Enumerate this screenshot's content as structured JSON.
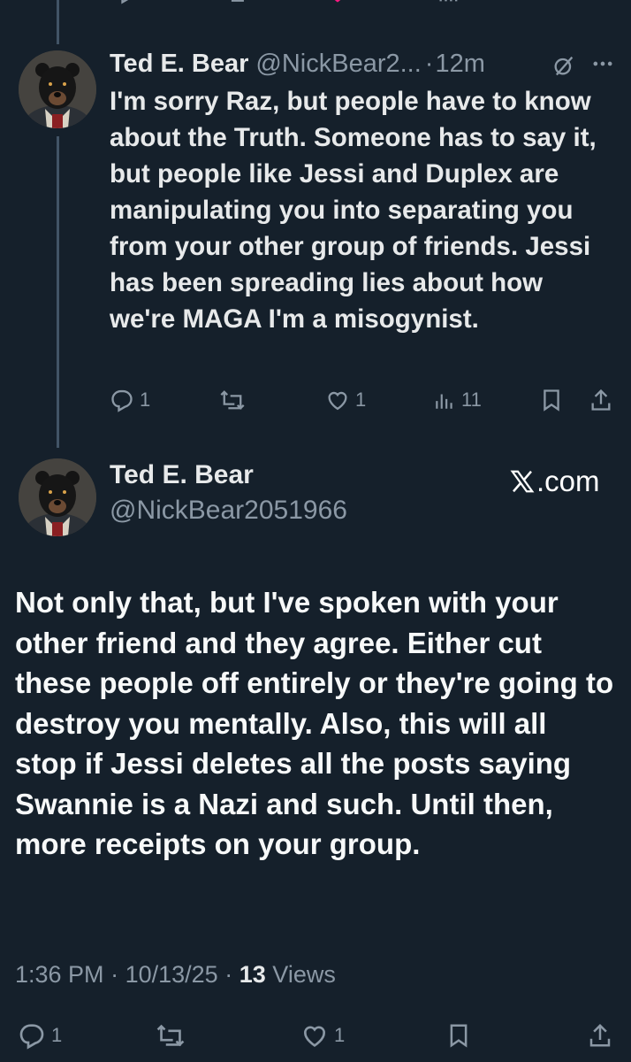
{
  "reply": {
    "name": "Ted E. Bear",
    "handle": "@NickBear2...",
    "separator": "·",
    "time": "12m",
    "text": "I'm sorry Raz, but people have to know about the Truth. Someone has to say it, but people like Jessi and Duplex are manipulating you into separating you from your other group of friends. Jessi has been spreading lies about how we're MAGA I'm a misogynist.",
    "actions": {
      "replies": "1",
      "reposts": "",
      "likes": "1",
      "views": "11"
    }
  },
  "main_post": {
    "name": "Ted E. Bear",
    "handle": "@NickBear2051966",
    "source": ".com",
    "text": "Not only that, but I've spoken with your other friend and they agree. Either cut these people off entirely or they're going to destroy you mentally. Also, this will all stop if Jessi deletes all the posts saying Swannie is a Nazi and such. Until then, more receipts on your group.",
    "time": "1:36 PM",
    "date": "10/13/25",
    "separator": "·",
    "views_count": "13",
    "views_label": "Views",
    "actions": {
      "replies": "1",
      "reposts": "",
      "likes": "1"
    }
  },
  "icons": {
    "reply": "reply-icon",
    "repost": "repost-icon",
    "like": "heart-icon",
    "views": "views-icon",
    "bookmark": "bookmark-icon",
    "share": "share-icon",
    "grok": "grok-icon",
    "more": "more-icon",
    "x_logo": "x-logo-icon"
  },
  "colors": {
    "background": "#15202b",
    "text_primary": "#e7e9ea",
    "text_secondary": "#8b98a5",
    "thread_line": "#425466",
    "like_active": "#f91880"
  }
}
